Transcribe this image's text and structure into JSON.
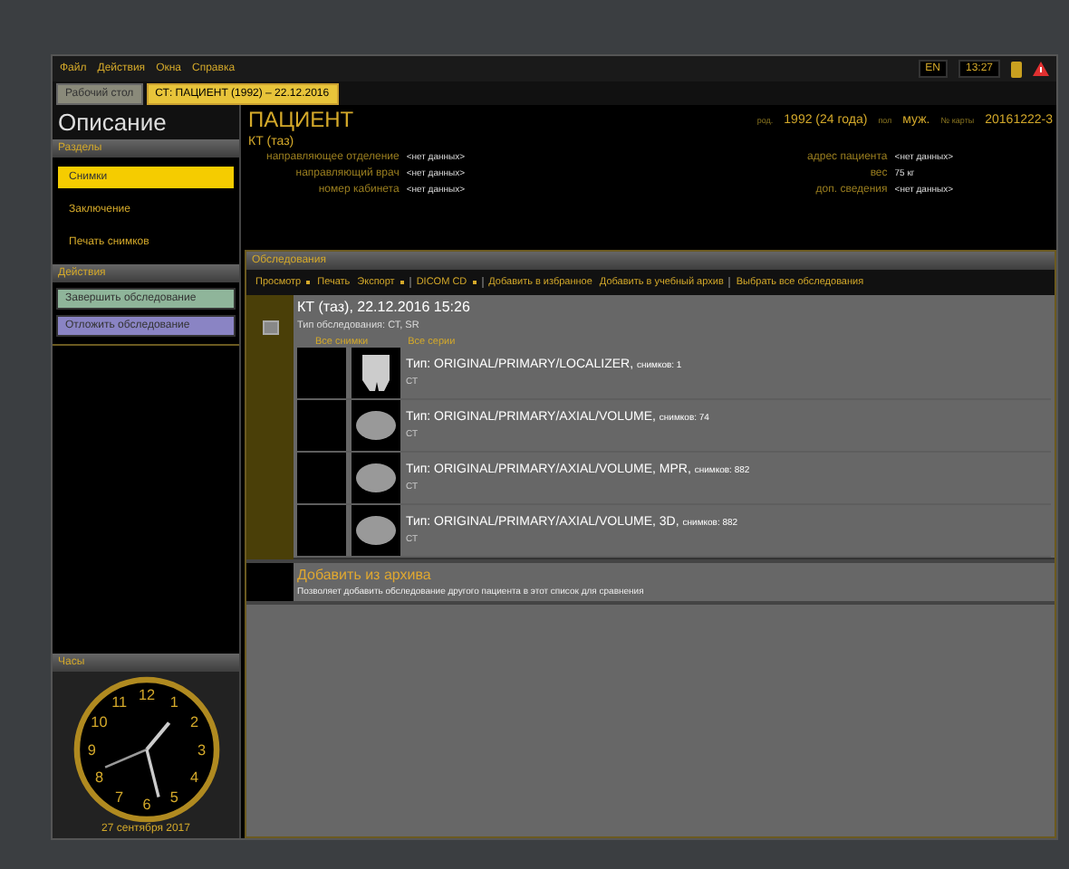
{
  "menu": [
    "Файл",
    "Действия",
    "Окна",
    "Справка"
  ],
  "status": {
    "language": "EN",
    "time": "13:27"
  },
  "tabs": [
    {
      "label": "Рабочий стол",
      "selected": false
    },
    {
      "label": "СТ: ПАЦИЕНТ (1992) – 22.12.2016",
      "selected": true
    }
  ],
  "sidebar": {
    "title": "Описание",
    "sections_header": "Разделы",
    "sections": [
      {
        "label": "Снимки",
        "selected": true
      },
      {
        "label": "Заключение",
        "selected": false
      },
      {
        "label": "Печать снимков",
        "selected": false
      }
    ],
    "actions_header": "Действия",
    "actions": [
      {
        "label": "Завершить обследование",
        "color": "#8fb59a"
      },
      {
        "label": "Отложить обследование",
        "color": "#8a84c4"
      }
    ],
    "clock_header": "Часы",
    "clock_numerals": [
      "12",
      "1",
      "2",
      "3",
      "4",
      "5",
      "6",
      "7",
      "8",
      "9",
      "10",
      "11"
    ],
    "date": "27 сентября 2017"
  },
  "patient": {
    "name": "ПАЦИЕНТ",
    "study": "КТ (таз)",
    "summary": [
      {
        "label": "род.",
        "value": "1992 (24 года)"
      },
      {
        "label": "пол",
        "value": "муж."
      },
      {
        "label": "№ карты",
        "value": "20161222-3"
      }
    ],
    "left_fields": [
      {
        "label": "направляющее отделение",
        "value": "<нет данных>"
      },
      {
        "label": "направляющий врач",
        "value": "<нет данных>"
      },
      {
        "label": "номер кабинета",
        "value": "<нет данных>"
      }
    ],
    "right_fields": [
      {
        "label": "адрес пациента",
        "value": "<нет данных>"
      },
      {
        "label": "вес",
        "value": "75 кг"
      },
      {
        "label": "доп. сведения",
        "value": "<нет данных>"
      }
    ]
  },
  "studies": {
    "header": "Обследования",
    "toolbar": [
      [
        {
          "label": "Просмотр",
          "dropdown": true
        },
        {
          "label": "Печать",
          "dropdown": false
        },
        {
          "label": "Экспорт",
          "dropdown": true
        }
      ],
      [
        {
          "label": "DICOM CD",
          "dropdown": true
        }
      ],
      [
        {
          "label": "Добавить в избранное",
          "dropdown": false
        },
        {
          "label": "Добавить в учебный архив",
          "dropdown": false
        }
      ],
      [
        {
          "label": "Выбрать все обследования",
          "dropdown": false
        }
      ]
    ],
    "study": {
      "title": "КТ (таз), 22.12.2016 15:26",
      "type": "Тип обследования: СТ, SR",
      "links": [
        "Все снимки",
        "Все серии"
      ],
      "series": [
        {
          "type": "Тип: ORIGINAL/PRIMARY/LOCALIZER,",
          "count": "снимков: 1",
          "modality": "СТ",
          "kind": "localizer"
        },
        {
          "type": "Тип: ORIGINAL/PRIMARY/AXIAL/VOLUME,",
          "count": "снимков: 74",
          "modality": "СТ",
          "kind": "axial"
        },
        {
          "type": "Тип: ORIGINAL/PRIMARY/AXIAL/VOLUME, MPR,",
          "count": "снимков: 882",
          "modality": "СТ",
          "kind": "axial"
        },
        {
          "type": "Тип: ORIGINAL/PRIMARY/AXIAL/VOLUME, 3D,",
          "count": "снимков: 882",
          "modality": "СТ",
          "kind": "axial"
        }
      ]
    },
    "add": {
      "title": "Добавить из архива",
      "description": "Позволяет добавить обследование другого пациента в этот список для сравнения"
    }
  }
}
